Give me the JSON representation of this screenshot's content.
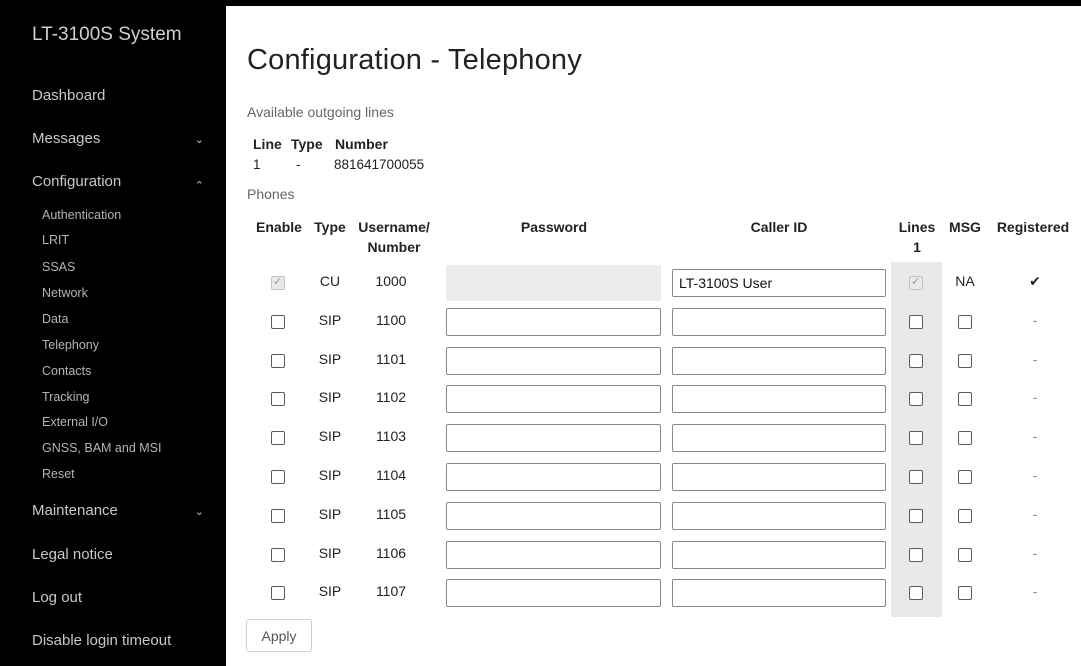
{
  "sidebar": {
    "brand": "LT-3100S System",
    "items": [
      {
        "label": "Dashboard",
        "chevron": ""
      },
      {
        "label": "Messages",
        "chevron": "⌄"
      },
      {
        "label": "Configuration",
        "chevron": "⌃"
      },
      {
        "label": "Maintenance",
        "chevron": "⌄"
      },
      {
        "label": "Legal notice",
        "chevron": ""
      },
      {
        "label": "Log out",
        "chevron": ""
      },
      {
        "label": "Disable login timeout",
        "chevron": ""
      }
    ],
    "sub_items": [
      "Authentication",
      "LRIT",
      "SSAS",
      "Network",
      "Data",
      "Telephony",
      "Contacts",
      "Tracking",
      "External I/O",
      "GNSS, BAM and MSI",
      "Reset"
    ]
  },
  "main": {
    "title": "Configuration - Telephony",
    "outgoing_label": "Available outgoing lines",
    "lines_headers": [
      "Line",
      "Type",
      "Number"
    ],
    "lines_row": [
      "1",
      "-",
      "881641700055"
    ],
    "phones_label": "Phones",
    "phone_headers": {
      "enable": "Enable",
      "type": "Type",
      "username1": "Username/",
      "username2": "Number",
      "password": "Password",
      "caller_id": "Caller ID",
      "lines1": "Lines",
      "lines2": "1",
      "msg": "MSG",
      "registered": "Registered"
    },
    "phones": [
      {
        "type": "CU",
        "number": "1000",
        "caller_id": "LT-3100S User",
        "msg": "NA",
        "registered": "✔",
        "disabled": true
      },
      {
        "type": "SIP",
        "number": "1100",
        "caller_id": "",
        "msg": "",
        "registered": "-",
        "disabled": false
      },
      {
        "type": "SIP",
        "number": "1101",
        "caller_id": "",
        "msg": "",
        "registered": "-",
        "disabled": false
      },
      {
        "type": "SIP",
        "number": "1102",
        "caller_id": "",
        "msg": "",
        "registered": "-",
        "disabled": false
      },
      {
        "type": "SIP",
        "number": "1103",
        "caller_id": "",
        "msg": "",
        "registered": "-",
        "disabled": false
      },
      {
        "type": "SIP",
        "number": "1104",
        "caller_id": "",
        "msg": "",
        "registered": "-",
        "disabled": false
      },
      {
        "type": "SIP",
        "number": "1105",
        "caller_id": "",
        "msg": "",
        "registered": "-",
        "disabled": false
      },
      {
        "type": "SIP",
        "number": "1106",
        "caller_id": "",
        "msg": "",
        "registered": "-",
        "disabled": false
      },
      {
        "type": "SIP",
        "number": "1107",
        "caller_id": "",
        "msg": "",
        "registered": "-",
        "disabled": false
      }
    ],
    "apply_label": "Apply"
  }
}
